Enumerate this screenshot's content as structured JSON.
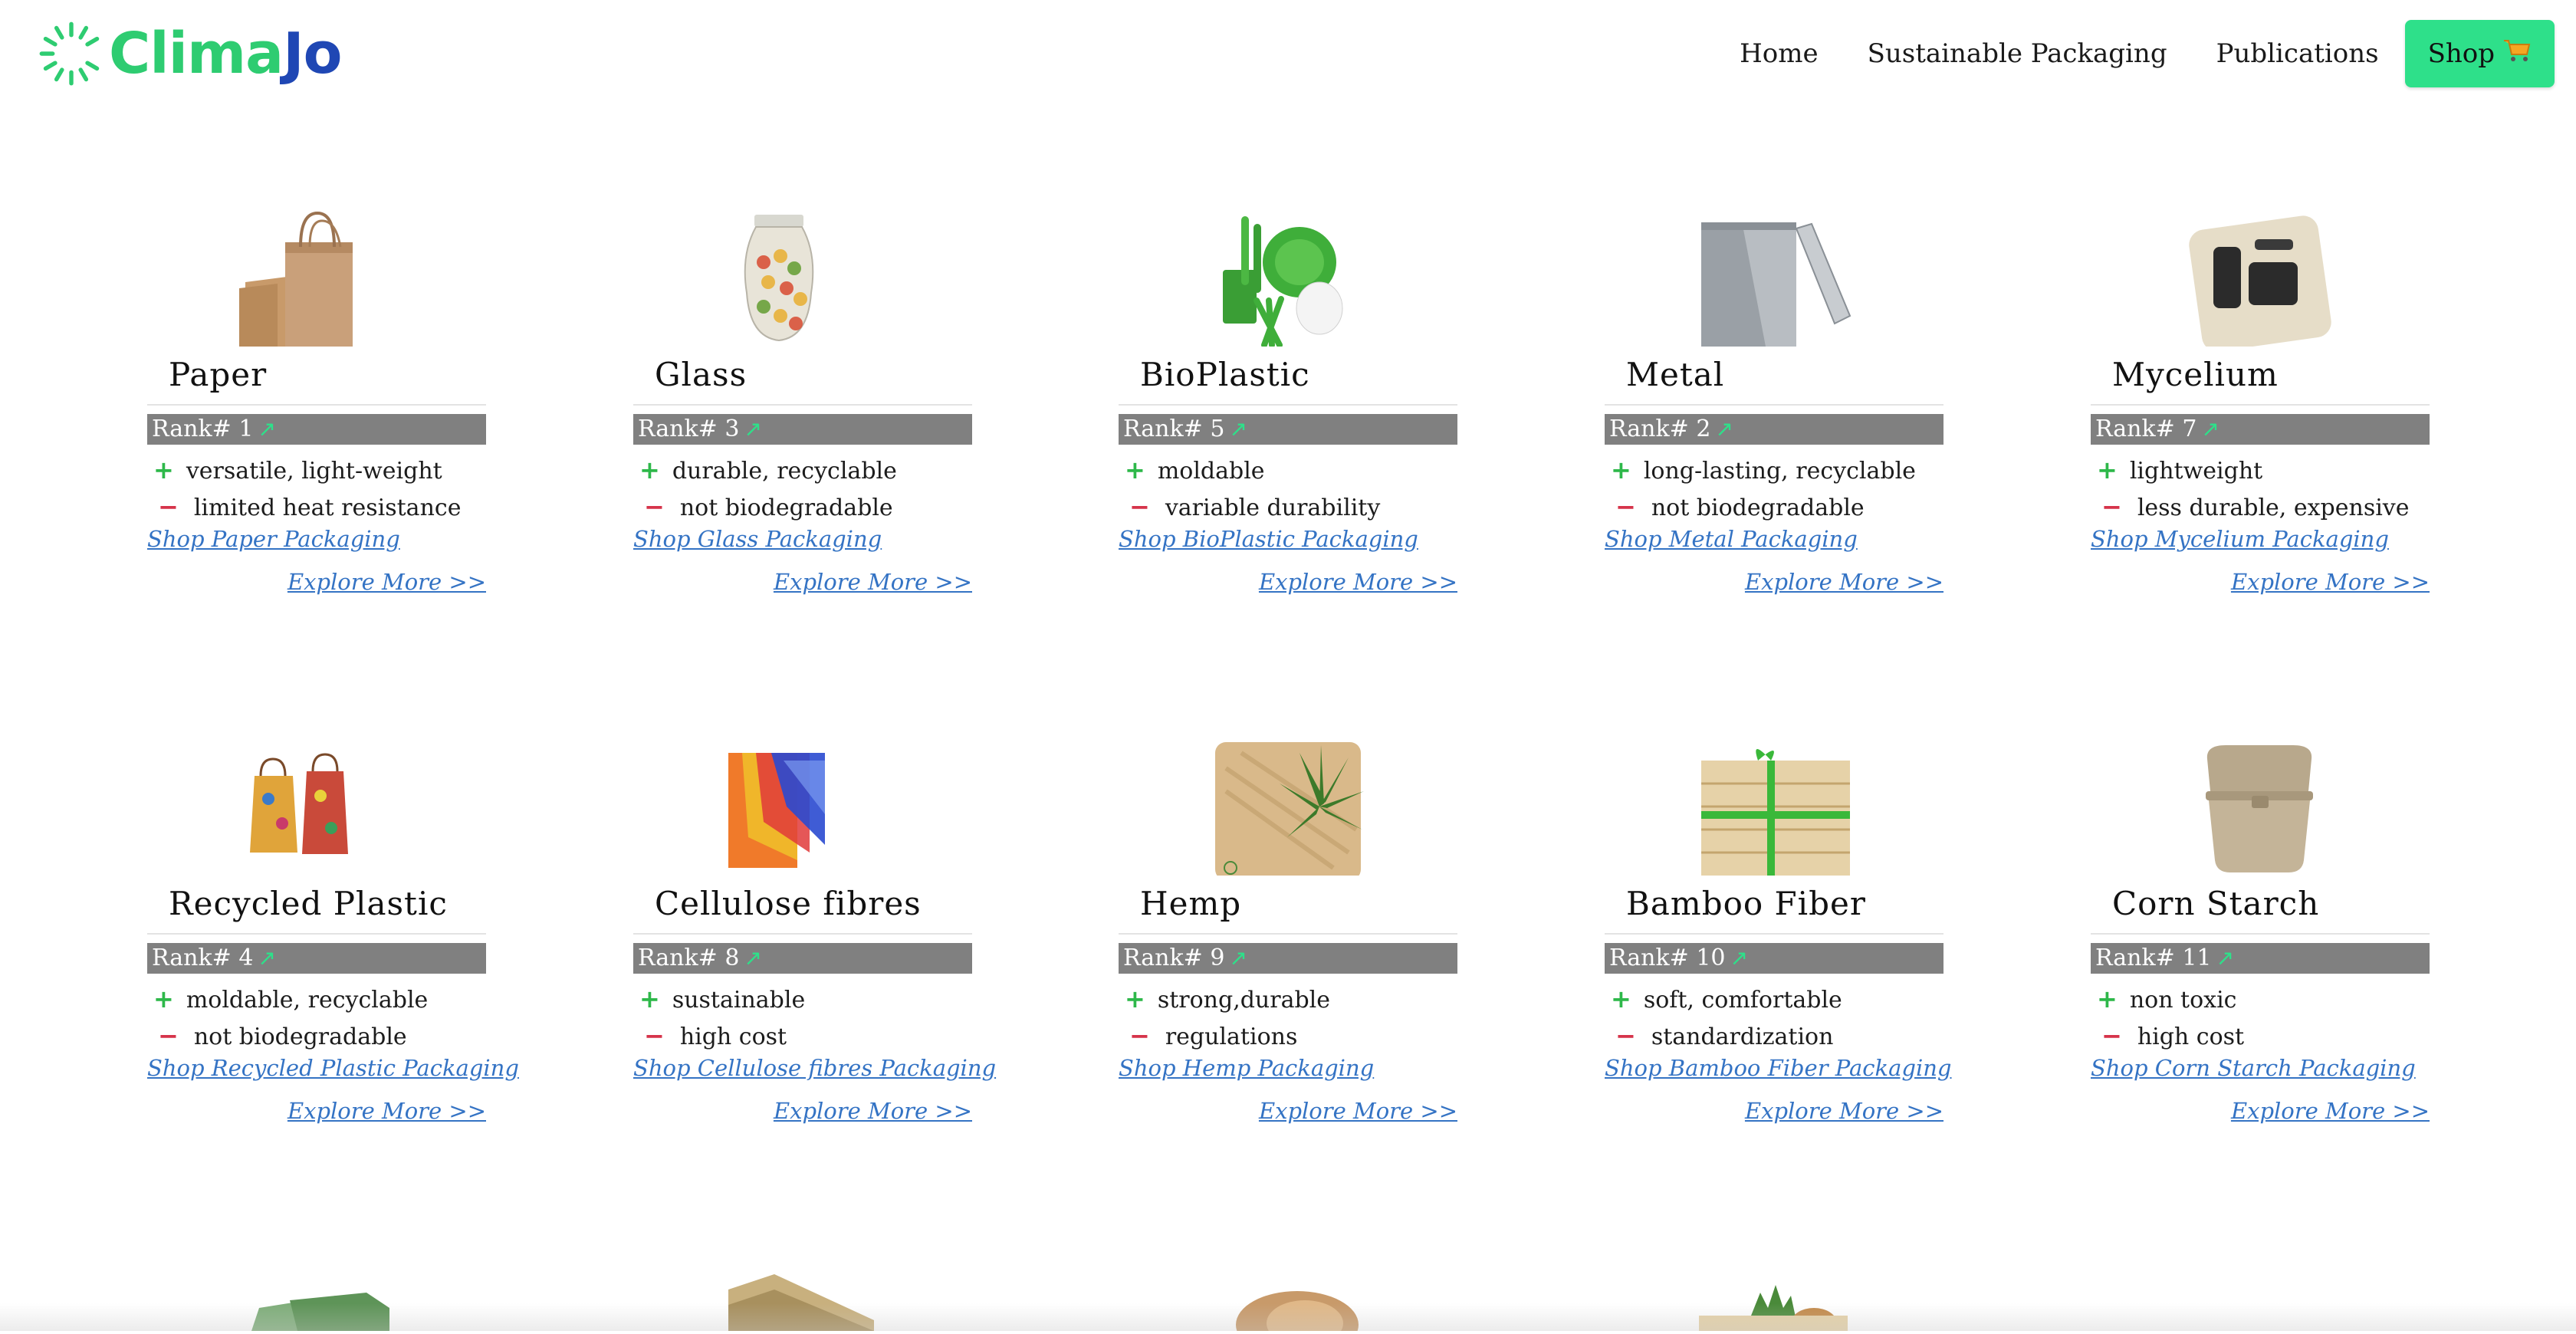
{
  "header": {
    "logo": {
      "part1": "Clima",
      "part2": "Jo"
    },
    "nav": [
      {
        "label": "Home"
      },
      {
        "label": "Sustainable Packaging"
      },
      {
        "label": "Publications"
      }
    ],
    "shop_label": "Shop",
    "shop_icon": "cart-icon"
  },
  "colors": {
    "accent": "#2ee08a",
    "brand_green": "#2ecc71",
    "brand_blue": "#1f47b4",
    "rank_bar": "#808080",
    "link": "#3473c4",
    "pro": "#2eb84a",
    "con": "#d6334a"
  },
  "cards": [
    {
      "title": "Paper",
      "rank": "Rank# 1",
      "pro": "versatile, light-weight",
      "con": "limited heat resistance",
      "shop": "Shop Paper Packaging",
      "explore": "Explore More >>",
      "image": "paper-bags-image"
    },
    {
      "title": "Glass",
      "rank": "Rank# 3",
      "pro": "durable, recyclable",
      "con": "not biodegradable",
      "shop": "Shop Glass Packaging",
      "explore": "Explore More >>",
      "image": "glass-jar-image"
    },
    {
      "title": "BioPlastic",
      "rank": "Rank# 5",
      "pro": "moldable",
      "con": "variable durability",
      "shop": "Shop BioPlastic Packaging",
      "explore": "Explore More >>",
      "image": "bioplastic-tableware-image"
    },
    {
      "title": "Metal",
      "rank": "Rank# 2",
      "pro": "long-lasting, recyclable",
      "con": "not biodegradable",
      "shop": "Shop Metal Packaging",
      "explore": "Explore More >>",
      "image": "metal-tin-image"
    },
    {
      "title": "Mycelium",
      "rank": "Rank# 7",
      "pro": "lightweight",
      "con": "less durable, expensive",
      "shop": "Shop Mycelium Packaging",
      "explore": "Explore More >>",
      "image": "mycelium-box-image"
    },
    {
      "title": "Recycled Plastic",
      "rank": "Rank# 4",
      "pro": "moldable, recyclable",
      "con": "not biodegradable",
      "shop": "Shop Recycled Plastic Packaging",
      "explore": "Explore More >>",
      "image": "recycled-bags-image"
    },
    {
      "title": "Cellulose fibres",
      "rank": "Rank# 8",
      "pro": "sustainable",
      "con": "high cost",
      "shop": "Shop Cellulose fibres Packaging",
      "explore": "Explore More >>",
      "image": "cellulose-sheets-image"
    },
    {
      "title": "Hemp",
      "rank": "Rank# 9",
      "pro": "strong,durable",
      "con": "regulations",
      "shop": "Shop Hemp Packaging",
      "explore": "Explore More >>",
      "image": "hemp-box-image"
    },
    {
      "title": "Bamboo Fiber",
      "rank": "Rank# 10",
      "pro": "soft, comfortable",
      "con": "standardization",
      "shop": "Shop Bamboo Fiber Packaging",
      "explore": "Explore More >>",
      "image": "bamboo-gift-box-image"
    },
    {
      "title": "Corn Starch",
      "rank": "Rank# 11",
      "pro": "non toxic",
      "con": "high cost",
      "shop": "Shop Corn Starch Packaging",
      "explore": "Explore More >>",
      "image": "corn-starch-container-image"
    }
  ]
}
